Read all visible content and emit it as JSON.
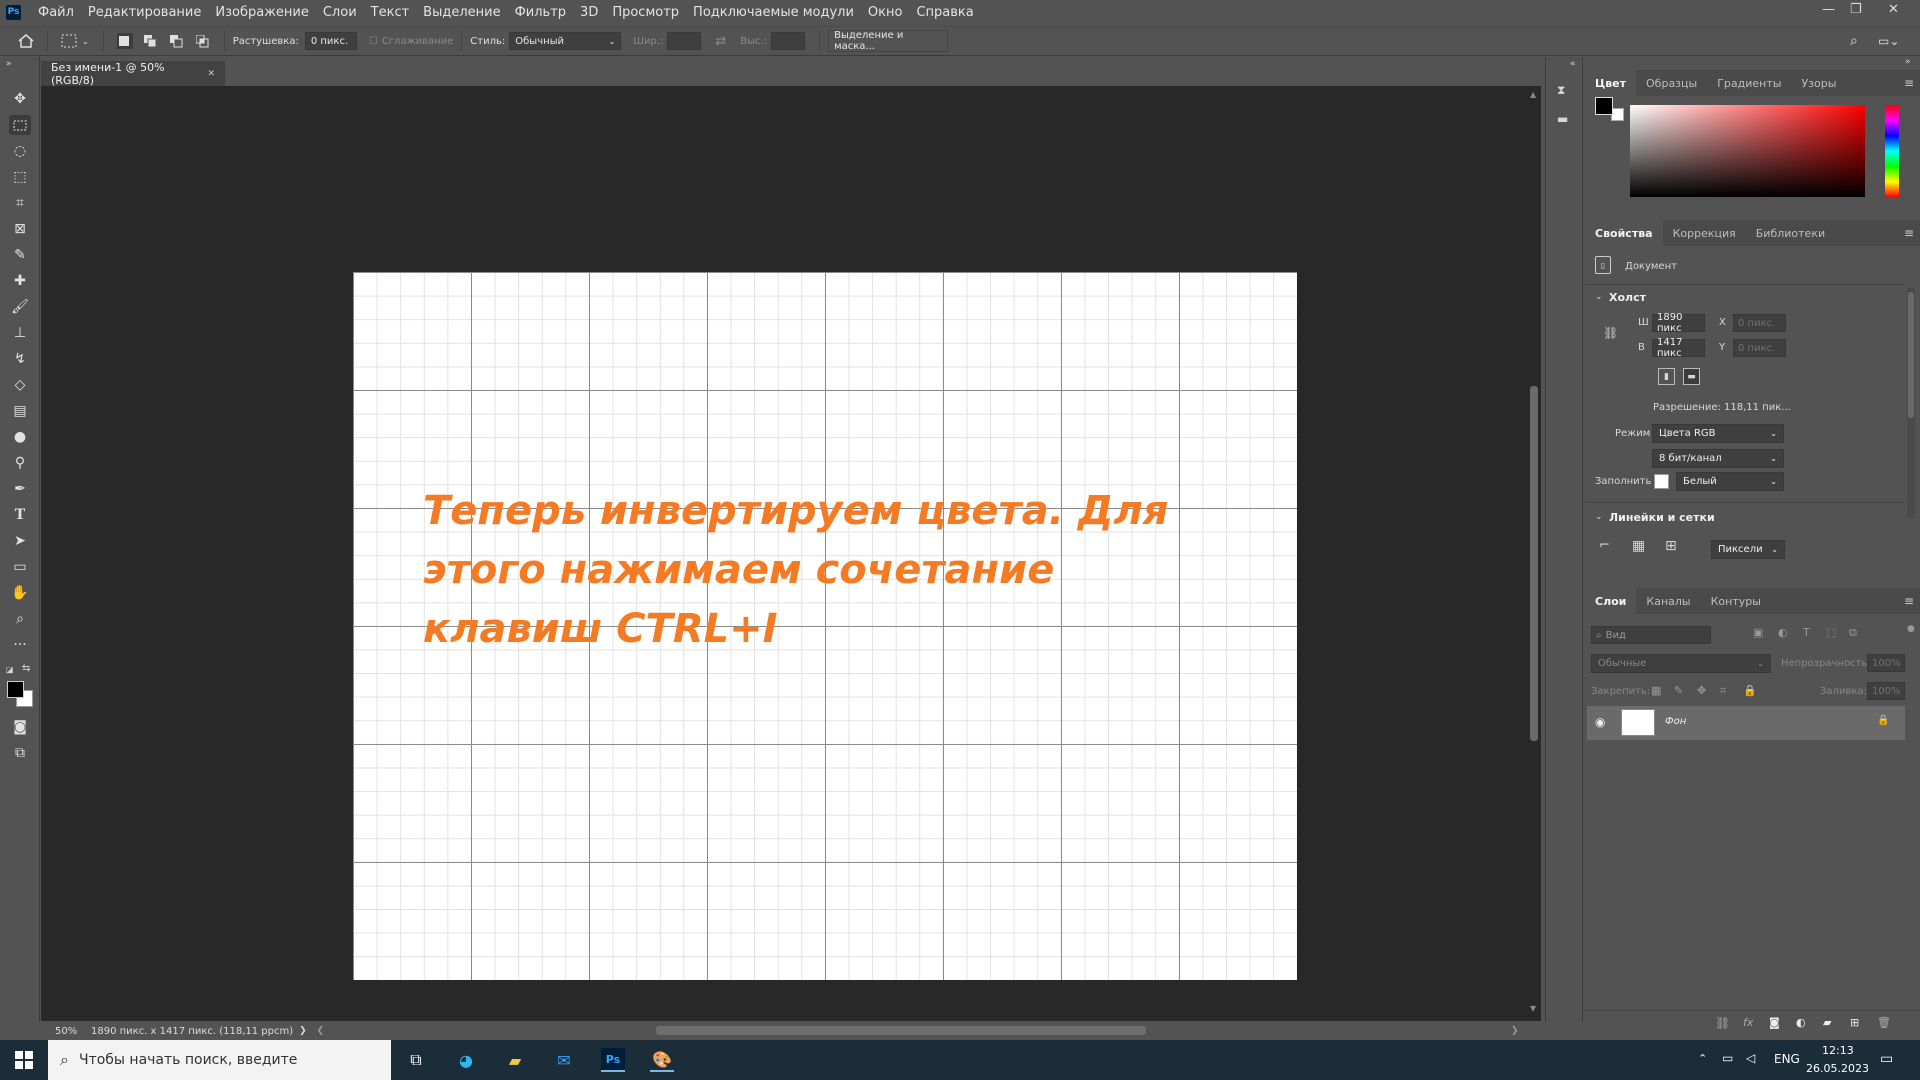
{
  "app": {
    "logo": "Ps",
    "accent": "#31a8ff"
  },
  "menu": [
    "Файл",
    "Редактирование",
    "Изображение",
    "Слои",
    "Текст",
    "Выделение",
    "Фильтр",
    "3D",
    "Просмотр",
    "Подключаемые модули",
    "Окно",
    "Справка"
  ],
  "options": {
    "feather_label": "Растушевка:",
    "feather_value": "0 пикс.",
    "antialias_label": "Сглаживание",
    "style_label": "Стиль:",
    "style_value": "Обычный",
    "width_label": "Шир.:",
    "height_label": "Выс.:",
    "select_mask_button": "Выделение и маска..."
  },
  "document": {
    "tab_title": "Без имени-1 @ 50% (RGB/8)",
    "canvas_text": "Теперь инвертируем цвета. Для этого нажимаем сочетание клавиш CTRL+I",
    "text_color": "#f47a24"
  },
  "status": {
    "zoom": "50%",
    "info": "1890 пикс. x 1417 пикс. (118,11 ppcm)"
  },
  "color_panel": {
    "tabs": [
      "Цвет",
      "Образцы",
      "Градиенты",
      "Узоры"
    ]
  },
  "properties_panel": {
    "tabs": [
      "Свойства",
      "Коррекция",
      "Библиотеки"
    ],
    "doc_label": "Документ",
    "canvas_section": "Холст",
    "w_label": "Ш",
    "w_value": "1890 пикс",
    "h_label": "В",
    "h_value": "1417 пикс",
    "x_label": "X",
    "x_placeholder": "0 пикс.",
    "y_label": "Y",
    "y_placeholder": "0 пикс.",
    "resolution": "Разрешение: 118,11 пик...",
    "mode_label": "Режим",
    "mode_value": "Цвета RGB",
    "depth_value": "8 бит/канал",
    "fill_label": "Заполнить",
    "fill_value": "Белый",
    "rulers_section": "Линейки и сетки",
    "units_value": "Пиксели"
  },
  "layers_panel": {
    "tabs": [
      "Слои",
      "Каналы",
      "Контуры"
    ],
    "search_placeholder": "Вид",
    "blend_mode": "Обычные",
    "opacity_label": "Непрозрачность:",
    "opacity_value": "100%",
    "lock_label": "Закрепить:",
    "fill_label": "Заливка:",
    "fill_value": "100%",
    "layers": [
      {
        "name": "Фон",
        "visible": true,
        "locked": true
      }
    ]
  },
  "taskbar": {
    "search_placeholder": "Чтобы начать поиск, введите",
    "lang": "ENG",
    "time": "12:13",
    "date": "26.05.2023"
  }
}
